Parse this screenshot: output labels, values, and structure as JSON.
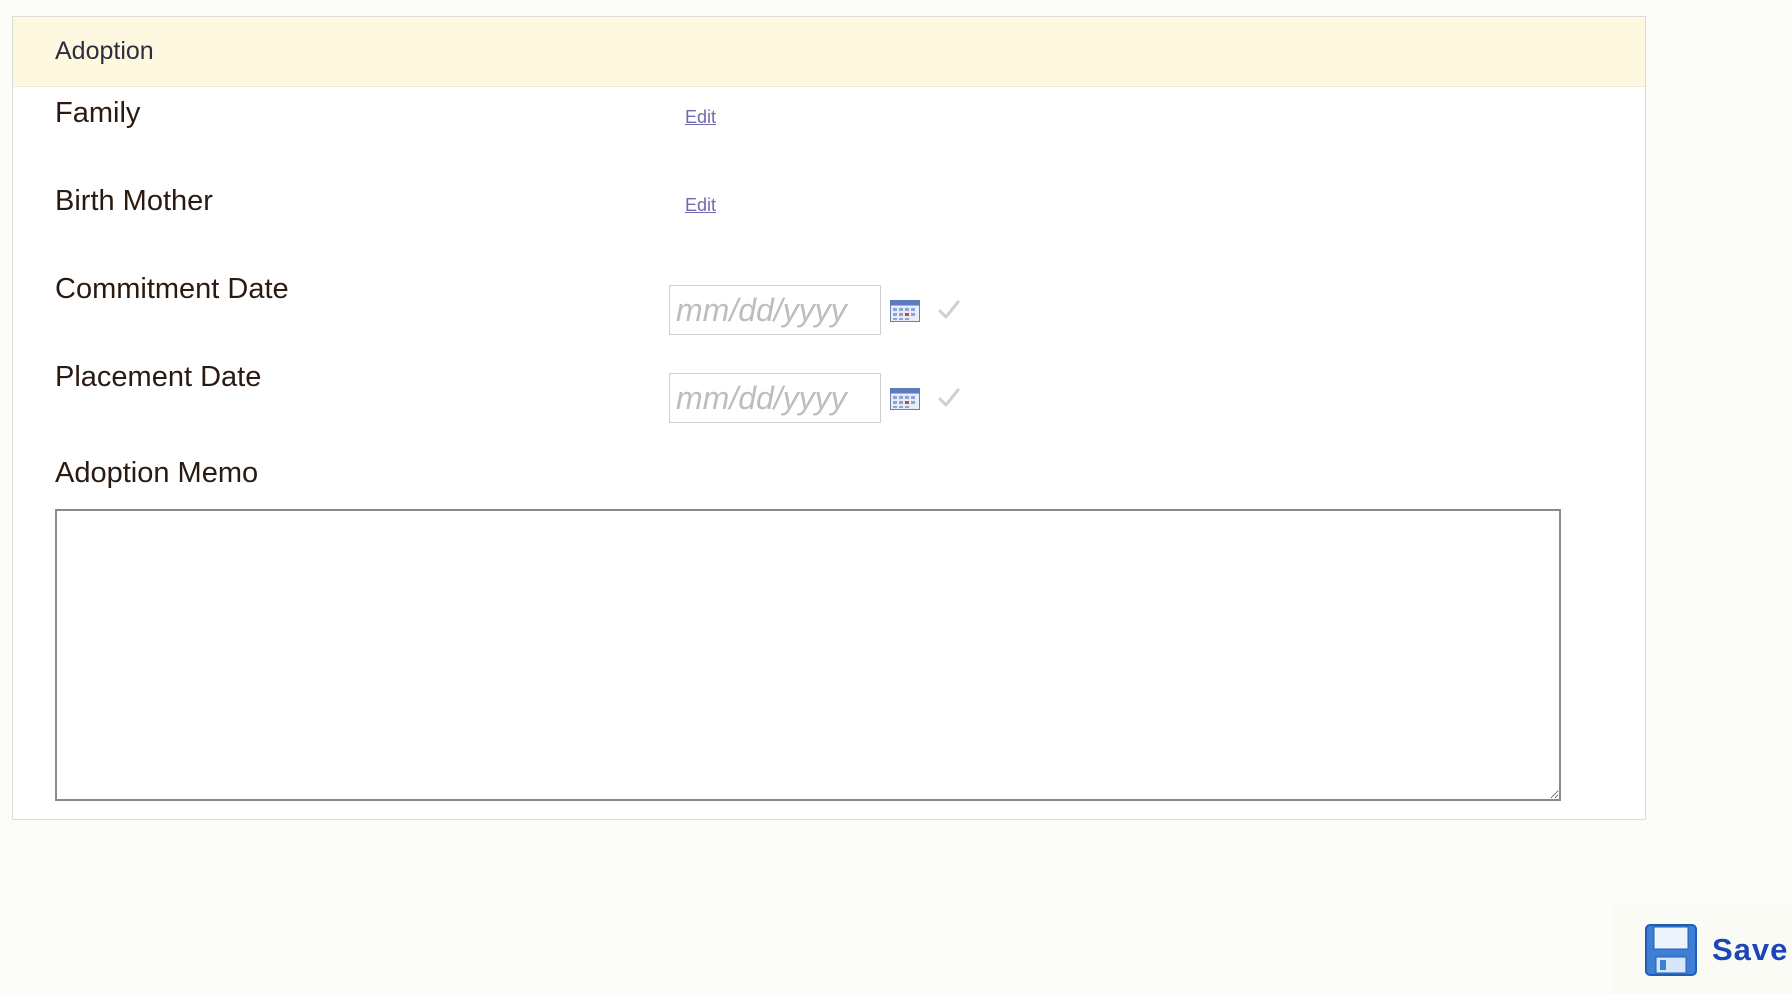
{
  "section": {
    "title": "Adoption"
  },
  "fields": {
    "family": {
      "label": "Family",
      "edit": "Edit"
    },
    "birth_mother": {
      "label": "Birth Mother",
      "edit": "Edit"
    },
    "commitment_date": {
      "label": "Commitment Date",
      "placeholder": "mm/dd/yyyy",
      "value": ""
    },
    "placement_date": {
      "label": "Placement Date",
      "placeholder": "mm/dd/yyyy",
      "value": ""
    },
    "memo": {
      "label": "Adoption Memo",
      "value": ""
    }
  },
  "actions": {
    "save_label": "Save"
  },
  "icons": {
    "calendar": "calendar-icon",
    "check": "check-icon",
    "save": "floppy-disk-icon"
  },
  "colors": {
    "header_bg": "#fef8e0",
    "link": "#6f6ab0",
    "save_text": "#1c46b8"
  }
}
